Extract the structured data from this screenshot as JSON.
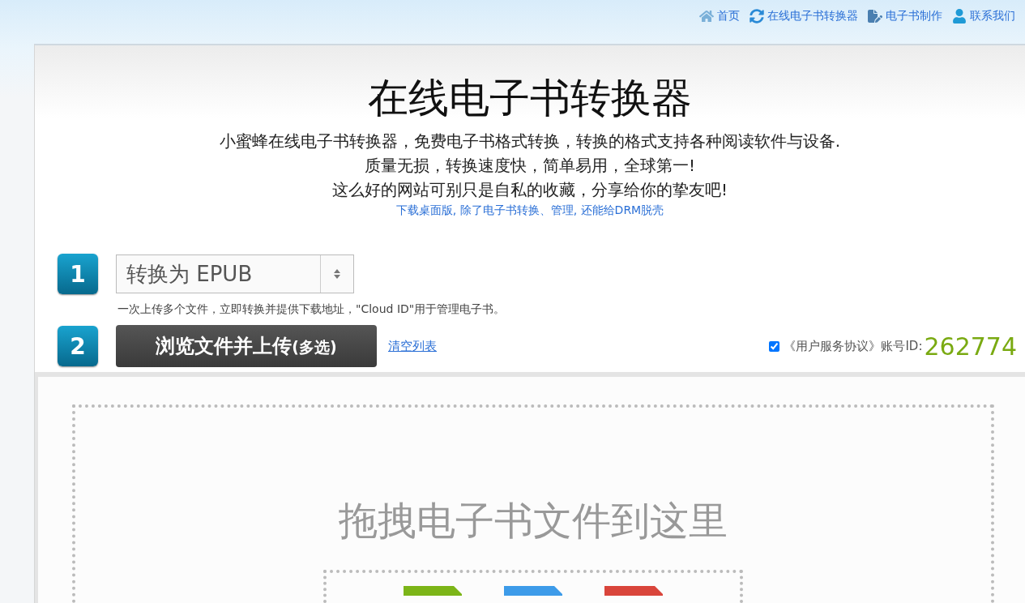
{
  "nav": [
    {
      "kind": "home",
      "label": "首页"
    },
    {
      "kind": "refresh",
      "label": "在线电子书转换器"
    },
    {
      "kind": "edit",
      "label": "电子书制作"
    },
    {
      "kind": "user",
      "label": "联系我们"
    }
  ],
  "title": "在线电子书转换器",
  "intro": [
    "小蜜蜂在线电子书转换器，免费电子书格式转换，转换的格式支持各种阅读软件与设备.",
    "质量无损，转换速度快，简单易用，全球第一!",
    "这么好的网站可别只是自私的收藏，分享给你的挚友吧!"
  ],
  "download_link": "下载桌面版, 除了电子书转换、管理, 还能给DRM脱壳",
  "step1": {
    "number": "1",
    "select_value": "转换为 EPUB",
    "hint": "一次上传多个文件，立即转换并提供下载地址，\"Cloud ID\"用于管理电子书。"
  },
  "step2": {
    "number": "2",
    "button": "浏览文件并上传",
    "button_suffix": "(多选)",
    "clear_link": "清空列表"
  },
  "agreement": {
    "checked": true,
    "label": "《用户服务协议》账号ID:",
    "account_id": "262774"
  },
  "dropzone": {
    "text": "拖拽电子书文件到这里",
    "file_icons": [
      {
        "color": "#7cb518"
      },
      {
        "color": "#3d9be9"
      },
      {
        "color": "#d9453b"
      }
    ]
  }
}
